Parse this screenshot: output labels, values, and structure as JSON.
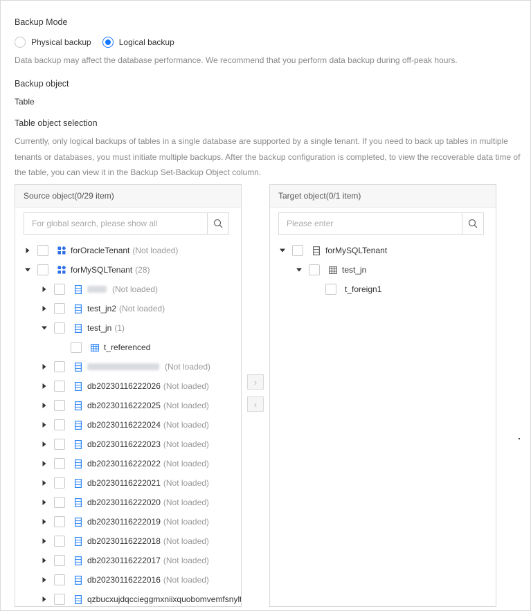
{
  "backup_mode": {
    "label": "Backup Mode",
    "options": [
      {
        "label": "Physical backup",
        "checked": false
      },
      {
        "label": "Logical backup",
        "checked": true
      }
    ],
    "notice": "Data backup may affect the database performance. We recommend that you perform data backup during off-peak hours."
  },
  "backup_object": {
    "label": "Backup object",
    "value": "Table"
  },
  "table_selection": {
    "label": "Table object selection",
    "description": "Currently, only logical backups of tables in a single database are supported by a single tenant. If you need to back up tables in multiple tenants or databases, you must initiate multiple backups. After the backup configuration is completed, to view the recoverable data time of the table, you can view it in the Backup Set-Backup Object column."
  },
  "source": {
    "title": "Source object",
    "count": "(0/29 item)",
    "search_placeholder": "For global search, please show all",
    "tree": [
      {
        "name": "forOracleTenant",
        "suffix": "(Not loaded)",
        "icon": "tenant-icon",
        "level": 0,
        "caret": "right"
      },
      {
        "name": "forMySQLTenant",
        "suffix": "(28)",
        "icon": "tenant-icon",
        "level": 0,
        "caret": "down"
      },
      {
        "name": "",
        "suffix": "(Not loaded)",
        "icon": "database-icon",
        "level": 1,
        "caret": "right",
        "blurred": true
      },
      {
        "name": "test_jn2",
        "suffix": "(Not loaded)",
        "icon": "database-icon",
        "level": 1,
        "caret": "right"
      },
      {
        "name": "test_jn",
        "suffix": "(1)",
        "icon": "database-icon",
        "level": 1,
        "caret": "down"
      },
      {
        "name": "t_referenced",
        "suffix": "",
        "icon": "table-icon",
        "level": 2,
        "caret": "none"
      },
      {
        "name": "",
        "suffix": "(Not loaded)",
        "icon": "database-icon",
        "level": 1,
        "caret": "right",
        "blurred": true
      },
      {
        "name": "db20230116222026",
        "suffix": "(Not loaded)",
        "icon": "database-icon",
        "level": 1,
        "caret": "right"
      },
      {
        "name": "db20230116222025",
        "suffix": "(Not loaded)",
        "icon": "database-icon",
        "level": 1,
        "caret": "right"
      },
      {
        "name": "db20230116222024",
        "suffix": "(Not loaded)",
        "icon": "database-icon",
        "level": 1,
        "caret": "right"
      },
      {
        "name": "db20230116222023",
        "suffix": "(Not loaded)",
        "icon": "database-icon",
        "level": 1,
        "caret": "right"
      },
      {
        "name": "db20230116222022",
        "suffix": "(Not loaded)",
        "icon": "database-icon",
        "level": 1,
        "caret": "right"
      },
      {
        "name": "db20230116222021",
        "suffix": "(Not loaded)",
        "icon": "database-icon",
        "level": 1,
        "caret": "right"
      },
      {
        "name": "db20230116222020",
        "suffix": "(Not loaded)",
        "icon": "database-icon",
        "level": 1,
        "caret": "right"
      },
      {
        "name": "db20230116222019",
        "suffix": "(Not loaded)",
        "icon": "database-icon",
        "level": 1,
        "caret": "right"
      },
      {
        "name": "db20230116222018",
        "suffix": "(Not loaded)",
        "icon": "database-icon",
        "level": 1,
        "caret": "right"
      },
      {
        "name": "db20230116222017",
        "suffix": "(Not loaded)",
        "icon": "database-icon",
        "level": 1,
        "caret": "right"
      },
      {
        "name": "db20230116222016",
        "suffix": "(Not loaded)",
        "icon": "database-icon",
        "level": 1,
        "caret": "right"
      },
      {
        "name": "qzbucxujdqccieggmxniixquobomvemfsnyltt",
        "suffix": "",
        "icon": "database-icon",
        "level": 1,
        "caret": "right"
      }
    ]
  },
  "target": {
    "title": "Target object",
    "count": "(0/1 item)",
    "search_placeholder": "Please enter",
    "tree": [
      {
        "name": "forMySQLTenant",
        "suffix": "",
        "icon": "tenant-gray-icon",
        "level": 0,
        "caret": "down"
      },
      {
        "name": "test_jn",
        "suffix": "",
        "icon": "table-gray-icon",
        "level": 1,
        "caret": "down"
      },
      {
        "name": "t_foreign1",
        "suffix": "",
        "icon": "",
        "level": 2,
        "caret": "none"
      }
    ]
  },
  "transfer": {
    "to_right": "›",
    "to_left": "‹"
  },
  "colors": {
    "accent": "#1677ff",
    "icon_blue": "#2f86f6",
    "border": "#d9d9d9",
    "header_bg": "#f7f7f7",
    "muted_text": "#8a8a8a"
  }
}
